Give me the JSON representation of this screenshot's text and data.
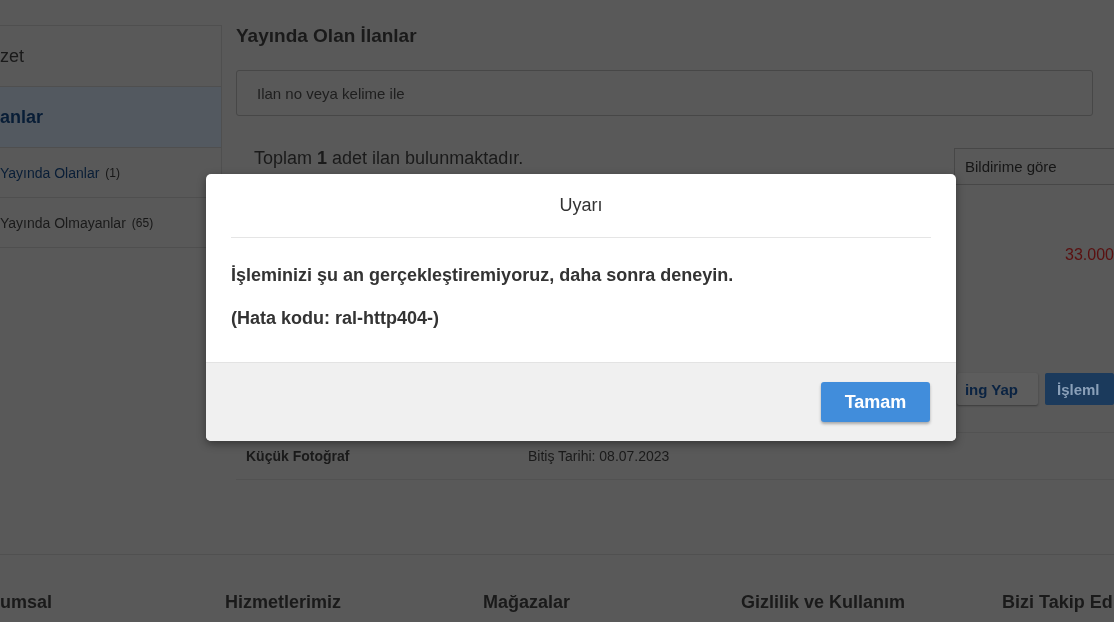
{
  "sidebar": {
    "items": [
      {
        "label": "zet",
        "selected": false
      },
      {
        "label": "anlar",
        "selected": true,
        "children": [
          {
            "label": "Yayında Olanlar",
            "count": "(1)",
            "selected": true
          },
          {
            "label": "Yayında Olmayanlar",
            "count": "(65)",
            "selected": false
          }
        ]
      }
    ]
  },
  "main": {
    "title": "Yayında Olan İlanlar",
    "search": {
      "placeholder": "Ilan no veya kelime ile"
    },
    "summary": "Toplam **1** adet ilan bulunmaktadır.",
    "sort_select": {
      "value": "Bildirime göre"
    },
    "listing": {
      "price": "33.000",
      "buttons": [
        {
          "label": "ing Yap",
          "kind": "secondary"
        },
        {
          "label": "İşleml",
          "kind": "primary"
        }
      ],
      "details": [
        "Küçük Fotoğraf",
        "Bitiş Tarihi: 08.07.2023"
      ]
    }
  },
  "footer": {
    "headings": [
      "umsal",
      "Hizmetlerimiz",
      "Mağazalar",
      "Gizlilik ve Kullanım",
      "Bizi Takip Ed"
    ]
  },
  "dialog": {
    "title": "Uyarı",
    "messages": [
      "İşleminizi şu an gerçekleştiremiyoruz, daha sonra deneyin.",
      "(Hata kodu: ral-http404-)"
    ],
    "button": "Tamam"
  }
}
